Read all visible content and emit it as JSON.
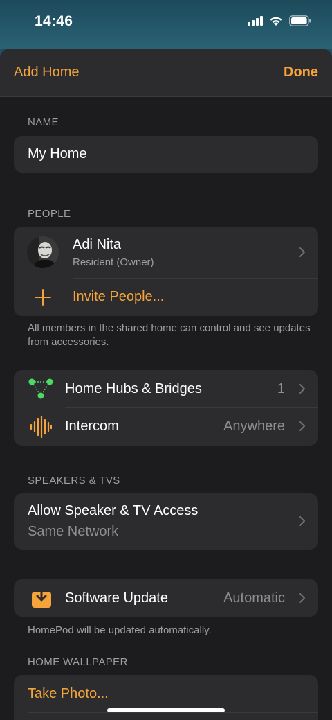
{
  "status": {
    "time": "14:46"
  },
  "nav": {
    "left": "Add Home",
    "right": "Done"
  },
  "name_section": {
    "label": "NAME",
    "value": "My Home"
  },
  "people_section": {
    "label": "PEOPLE",
    "person_name": "Adi Nita",
    "person_role": "Resident (Owner)",
    "invite": "Invite People...",
    "footnote": "All members in the shared home can control and see updates from accessories."
  },
  "hubs": {
    "hubs_label": "Home Hubs & Bridges",
    "hubs_value": "1",
    "intercom_label": "Intercom",
    "intercom_value": "Anywhere"
  },
  "speakers_section": {
    "label": "SPEAKERS & TVS",
    "title": "Allow Speaker & TV Access",
    "subtitle": "Same Network"
  },
  "software": {
    "label": "Software Update",
    "value": "Automatic",
    "footnote": "HomePod will be updated automatically."
  },
  "wallpaper_section": {
    "label": "HOME WALLPAPER",
    "take_photo": "Take Photo..."
  },
  "colors": {
    "accent": "#f4a43a",
    "hub_green": "#4cd964"
  }
}
